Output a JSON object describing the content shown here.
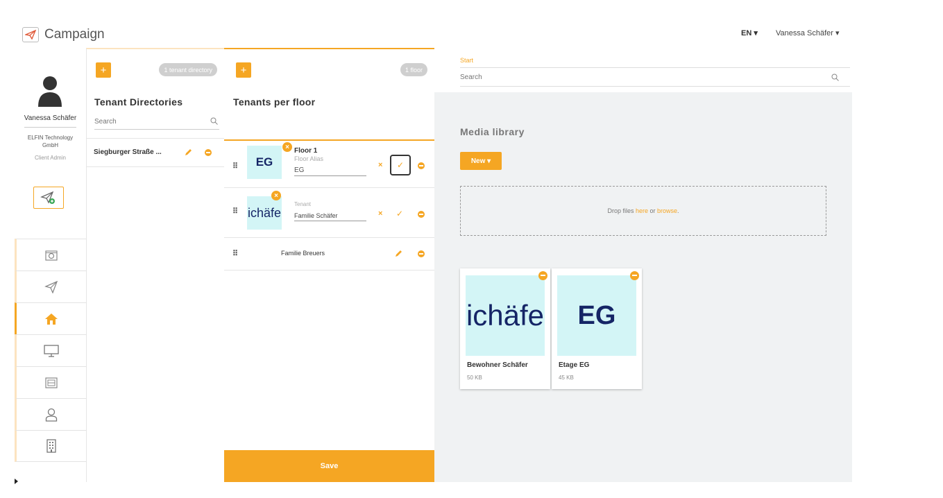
{
  "app": {
    "title": "Campaign",
    "language": "EN ▾",
    "user_menu": "Vanessa Schäfer ▾"
  },
  "profile": {
    "name": "Vanessa Schäfer",
    "company": "ELFIN Technology GmbH",
    "role": "Client Admin"
  },
  "nav": [
    {
      "icon": "media-icon",
      "active": false
    },
    {
      "icon": "paper-plane-icon",
      "active": false
    },
    {
      "icon": "house-icon",
      "active": true
    },
    {
      "icon": "monitor-icon",
      "active": false
    },
    {
      "icon": "layout-icon",
      "active": false
    },
    {
      "icon": "user-icon",
      "active": false
    },
    {
      "icon": "building-icon",
      "active": false
    }
  ],
  "directories": {
    "add_label": "+",
    "count_badge": "1 tenant directory",
    "title": "Tenant Directories",
    "search_placeholder": "Search",
    "items": [
      {
        "name": "Siegburger Straße ..."
      }
    ]
  },
  "floors": {
    "add_label": "+",
    "count_badge": "1 floor",
    "title": "Tenants per floor",
    "edit_floor": {
      "thumb_text": "EG",
      "name": "Floor 1",
      "alias_label": "Floor Alias",
      "alias_value": "EG"
    },
    "edit_tenant": {
      "thumb_text": "ichäfe",
      "tenant_label": "Tenant",
      "tenant_value": "Familie Schäfer"
    },
    "tenant_row": {
      "name": "Familie Breuers"
    },
    "save_label": "Save"
  },
  "media": {
    "breadcrumb": "Start",
    "search_placeholder": "Search",
    "title": "Media library",
    "new_label": "New ▾",
    "drop_prefix": "Drop files ",
    "drop_here": "here",
    "drop_middle": " or ",
    "drop_browse": "browse",
    "drop_suffix": ".",
    "cards": [
      {
        "thumb_text": "ichäfe",
        "name": "Bewohner Schäfer",
        "size": "50 KB"
      },
      {
        "thumb_text": "EG",
        "name": "Etage EG",
        "size": "45 KB"
      }
    ]
  },
  "colors": {
    "accent": "#f5a623",
    "thumb_bg": "#d3f5f6",
    "thumb_text": "#152566"
  }
}
